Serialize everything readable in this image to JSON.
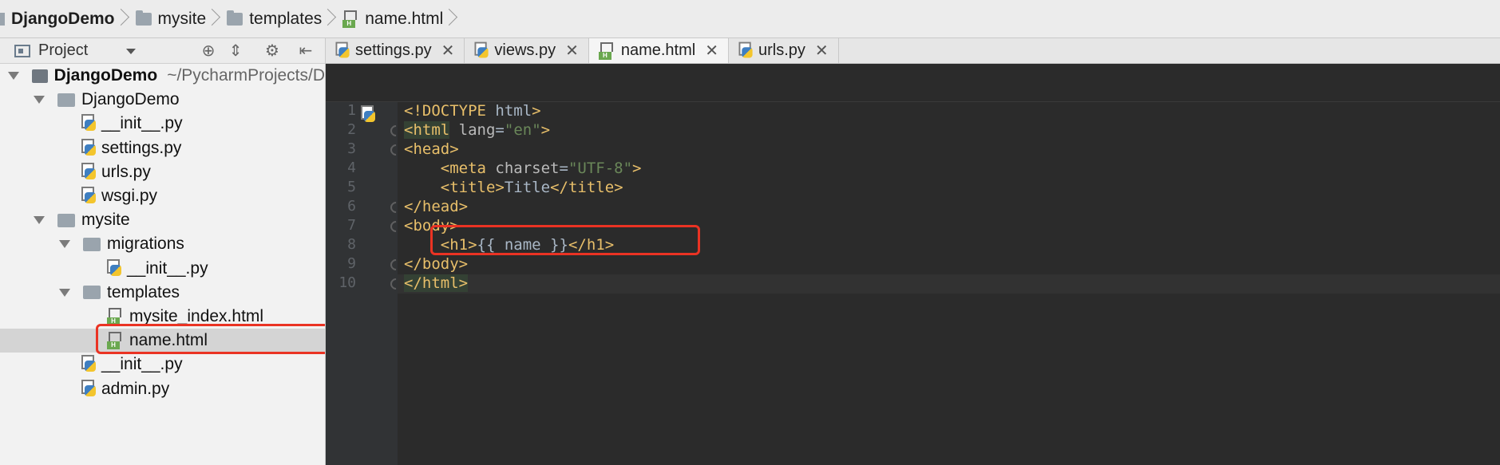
{
  "navbar": {
    "crumbs": [
      {
        "label": "DjangoDemo",
        "icon": "folder-icon"
      },
      {
        "label": "mysite",
        "icon": "folder-icon"
      },
      {
        "label": "templates",
        "icon": "folder-icon"
      },
      {
        "label": "name.html",
        "icon": "html-file-icon"
      }
    ]
  },
  "panel": {
    "title": "Project",
    "tools": [
      "target-icon",
      "collapse-icon",
      "gear-icon",
      "pin-icon"
    ]
  },
  "tree": [
    {
      "label": "DjangoDemo",
      "suffix": "~/PycharmProjects/D",
      "type": "folder",
      "depth": 0,
      "expanded": true,
      "bold": true
    },
    {
      "label": "DjangoDemo",
      "type": "folder",
      "depth": 1,
      "expanded": true
    },
    {
      "label": "__init__.py",
      "type": "py",
      "depth": 2
    },
    {
      "label": "settings.py",
      "type": "py",
      "depth": 2
    },
    {
      "label": "urls.py",
      "type": "py",
      "depth": 2
    },
    {
      "label": "wsgi.py",
      "type": "py",
      "depth": 2
    },
    {
      "label": "mysite",
      "type": "folder",
      "depth": 1,
      "expanded": true
    },
    {
      "label": "migrations",
      "type": "folder",
      "depth": 2,
      "expanded": true
    },
    {
      "label": "__init__.py",
      "type": "py",
      "depth": 3
    },
    {
      "label": "templates",
      "type": "folder",
      "depth": 2,
      "expanded": true
    },
    {
      "label": "mysite_index.html",
      "type": "html",
      "depth": 3
    },
    {
      "label": "name.html",
      "type": "html",
      "depth": 3,
      "selected": true
    },
    {
      "label": "__init__.py",
      "type": "py",
      "depth": 2
    },
    {
      "label": "admin.py",
      "type": "py",
      "depth": 2
    }
  ],
  "tabs": [
    {
      "label": "settings.py",
      "type": "py"
    },
    {
      "label": "views.py",
      "type": "py"
    },
    {
      "label": "name.html",
      "type": "html",
      "active": true
    },
    {
      "label": "urls.py",
      "type": "py"
    }
  ],
  "code": {
    "line_numbers": [
      "1",
      "2",
      "3",
      "4",
      "5",
      "6",
      "7",
      "8",
      "9",
      "10"
    ],
    "lines": [
      "<!DOCTYPE html>",
      "<html lang=\"en\">",
      "<head>",
      "    <meta charset=\"UTF-8\">",
      "    <title>Title</title>",
      "</head>",
      "<body>",
      "    <h1>{{ name }}</h1>",
      "</body>",
      "</html>"
    ]
  },
  "colors": {
    "editor_bg": "#2b2b2b",
    "tag": "#e8bf6a",
    "string": "#6a8759",
    "highlight_border": "#ea3323"
  }
}
